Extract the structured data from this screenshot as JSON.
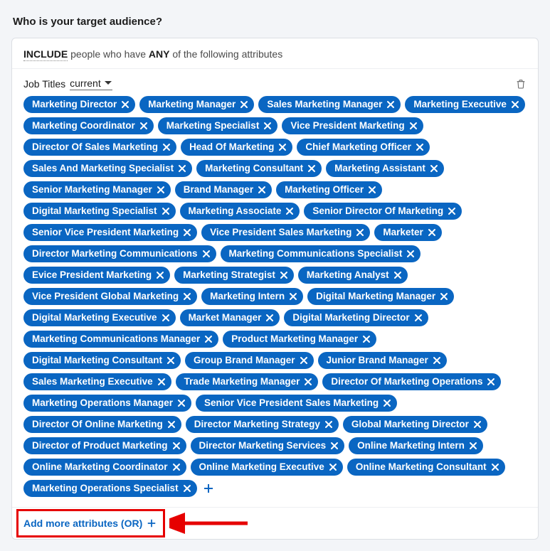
{
  "heading": "Who is your target audience?",
  "rule": {
    "include_kw": "INCLUDE",
    "mid": " people who have ",
    "any_kw": "ANY",
    "tail": " of the following attributes"
  },
  "criteria": {
    "label": "Job Titles",
    "scope": "current"
  },
  "chips": [
    "Marketing Director",
    "Marketing Manager",
    "Sales Marketing Manager",
    "Marketing Executive",
    "Marketing Coordinator",
    "Marketing Specialist",
    "Vice President Marketing",
    "Director Of Sales Marketing",
    "Head Of Marketing",
    "Chief Marketing Officer",
    "Sales And Marketing Specialist",
    "Marketing Consultant",
    "Marketing Assistant",
    "Senior Marketing Manager",
    "Brand Manager",
    "Marketing Officer",
    "Digital Marketing Specialist",
    "Marketing Associate",
    "Senior Director Of Marketing",
    "Senior Vice President Marketing",
    "Vice President Sales Marketing",
    "Marketer",
    "Director Marketing Communications",
    "Marketing Communications Specialist",
    "Evice President Marketing",
    "Marketing Strategist",
    "Marketing Analyst",
    "Vice President Global Marketing",
    "Marketing Intern",
    "Digital Marketing Manager",
    "Digital Marketing Executive",
    "Market Manager",
    "Digital Marketing Director",
    "Marketing Communications Manager",
    "Product Marketing Manager",
    "Digital Marketing Consultant",
    "Group Brand Manager",
    "Junior Brand Manager",
    "Sales Marketing Executive",
    "Trade Marketing Manager",
    "Director Of Marketing Operations",
    "Marketing Operations Manager",
    "Senior Vice President Sales Marketing",
    "Director Of Online Marketing",
    "Director Marketing Strategy",
    "Global Marketing Director",
    "Director of Product Marketing",
    "Director Marketing Services",
    "Online Marketing Intern",
    "Online Marketing Coordinator",
    "Online Marketing Executive",
    "Online Marketing Consultant",
    "Marketing Operations Specialist"
  ],
  "add_attr": "Add more attributes (OR)",
  "colors": {
    "accent": "#0a66c2",
    "annotation_red": "#e60000"
  }
}
